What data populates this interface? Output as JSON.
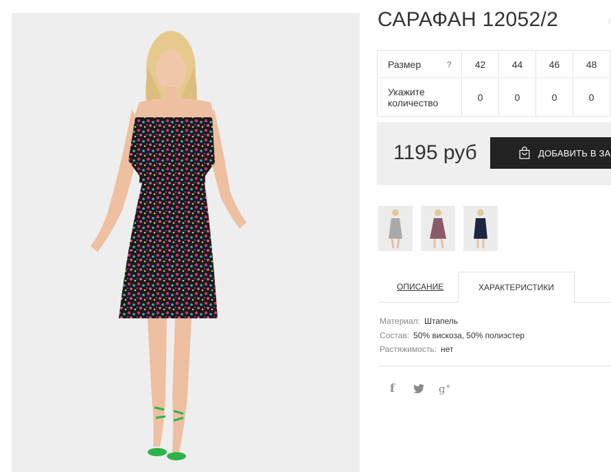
{
  "product": {
    "title": "САРАФАН 12052/2",
    "price": "1195 руб",
    "add_to_cart_label": "ДОБАВИТЬ В ЗАКАЗ"
  },
  "size_table": {
    "size_label": "Размер",
    "help": "?",
    "quantity_label": "Укажите количество",
    "sizes": [
      "42",
      "44",
      "46",
      "48"
    ],
    "quantities": [
      "0",
      "0",
      "0",
      "0"
    ]
  },
  "tabs": {
    "description": "ОПИСАНИЕ",
    "characteristics": "ХАРАКТЕРИСТИКИ"
  },
  "characteristics": [
    {
      "key": "Материал:",
      "value": "Штапель"
    },
    {
      "key": "Состав:",
      "value": "50% вискоза, 50% полиэстер"
    },
    {
      "key": "Растяжимость:",
      "value": "нет"
    }
  ],
  "social": {
    "facebook": "f",
    "gplus": "g"
  },
  "icons": {
    "bag": "shopping-bag-icon",
    "favorite": "star-icon",
    "facebook": "facebook-icon",
    "twitter": "twitter-icon",
    "gplus": "google-plus-icon"
  },
  "colors": {
    "button_bg": "#222222",
    "price_box_bg": "#efefef",
    "photo_bg": "#eeeeee",
    "shoe_green": "#2db34a"
  },
  "thumbnails": [
    {
      "dress_color": "#a9a9a9"
    },
    {
      "dress_color": "#8a5a6a"
    },
    {
      "dress_color": "#1e2540"
    }
  ]
}
